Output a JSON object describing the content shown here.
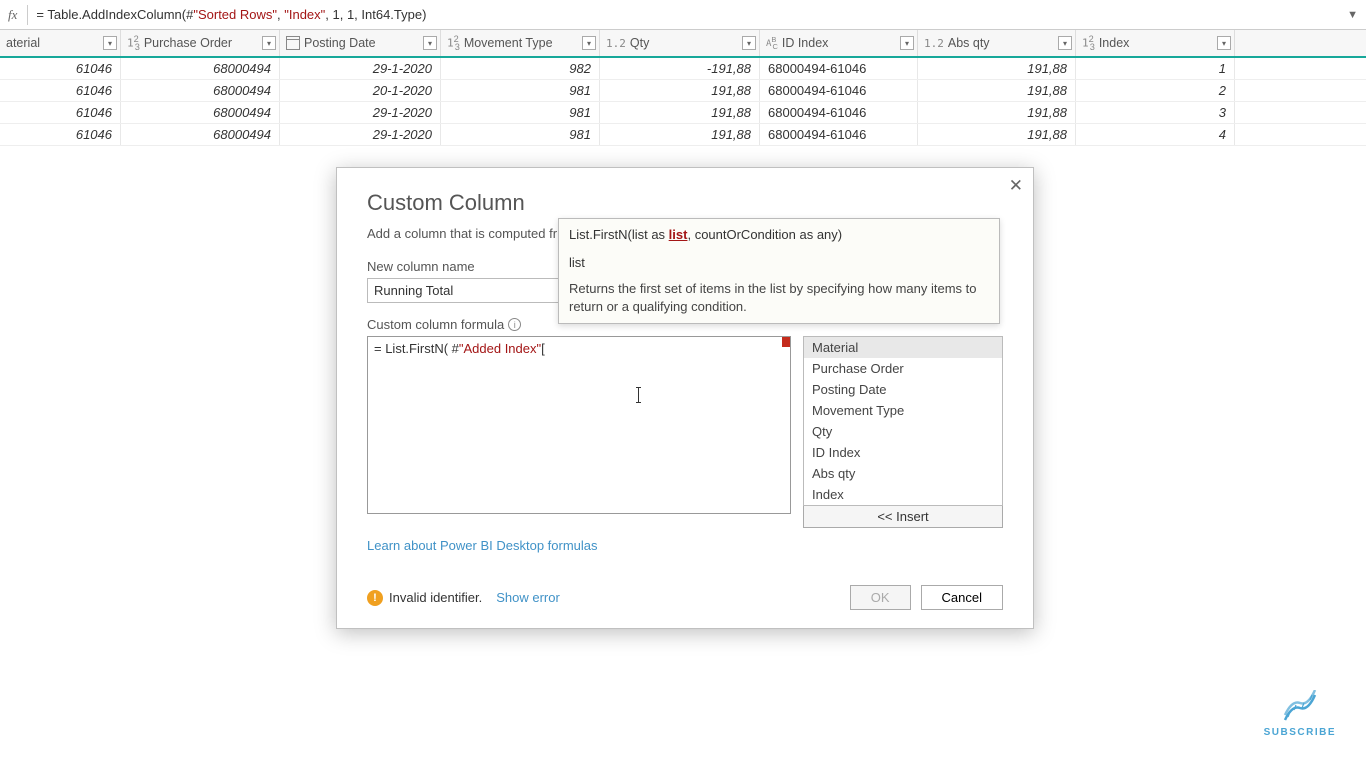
{
  "formulaBar": {
    "prefix": "= Table.AddIndexColumn(#",
    "str1": "\"Sorted Rows\"",
    "mid": ", ",
    "str2": "\"Index\"",
    "suffix": ", 1, 1, Int64.Type)"
  },
  "columns": {
    "material": "aterial",
    "po": "Purchase Order",
    "date": "Posting Date",
    "movement": "Movement Type",
    "qty": "Qty",
    "idIndex": "ID Index",
    "absQty": "Abs qty",
    "index": "Index"
  },
  "typeLabels": {
    "int": "1²₃",
    "dec": "1.2",
    "abc": "ABC"
  },
  "rows": [
    {
      "mat": "61046",
      "po": "68000494",
      "date": "29-1-2020",
      "mov": "982",
      "qty": "-191,88",
      "id": "68000494-61046",
      "abs": "191,88",
      "idx": "1"
    },
    {
      "mat": "61046",
      "po": "68000494",
      "date": "20-1-2020",
      "mov": "981",
      "qty": "191,88",
      "id": "68000494-61046",
      "abs": "191,88",
      "idx": "2"
    },
    {
      "mat": "61046",
      "po": "68000494",
      "date": "29-1-2020",
      "mov": "981",
      "qty": "191,88",
      "id": "68000494-61046",
      "abs": "191,88",
      "idx": "3"
    },
    {
      "mat": "61046",
      "po": "68000494",
      "date": "29-1-2020",
      "mov": "981",
      "qty": "191,88",
      "id": "68000494-61046",
      "abs": "191,88",
      "idx": "4"
    }
  ],
  "dialog": {
    "title": "Custom Column",
    "desc": "Add a column that is computed fr",
    "nameLabel": "New column name",
    "nameValue": "Running Total",
    "formulaLabel": "Custom column formula",
    "formulaPrefix": "= List.FirstN( #",
    "formulaStr": "\"Added Index\"",
    "formulaSuffix": "[",
    "learnLink": "Learn about Power BI Desktop formulas",
    "status": "Invalid identifier.",
    "showError": "Show error",
    "ok": "OK",
    "cancel": "Cancel",
    "insertBtn": "<< Insert"
  },
  "availColumns": [
    "Material",
    "Purchase Order",
    "Posting Date",
    "Movement Type",
    "Qty",
    "ID Index",
    "Abs qty",
    "Index"
  ],
  "tooltip": {
    "sigPre": "List.FirstN(list as ",
    "sigHl": "list",
    "sigPost": ", countOrCondition as any)",
    "param": "list",
    "desc": "Returns the first set of items in the list by specifying how many items to return or a qualifying condition."
  },
  "subscribe": "SUBSCRIBE"
}
